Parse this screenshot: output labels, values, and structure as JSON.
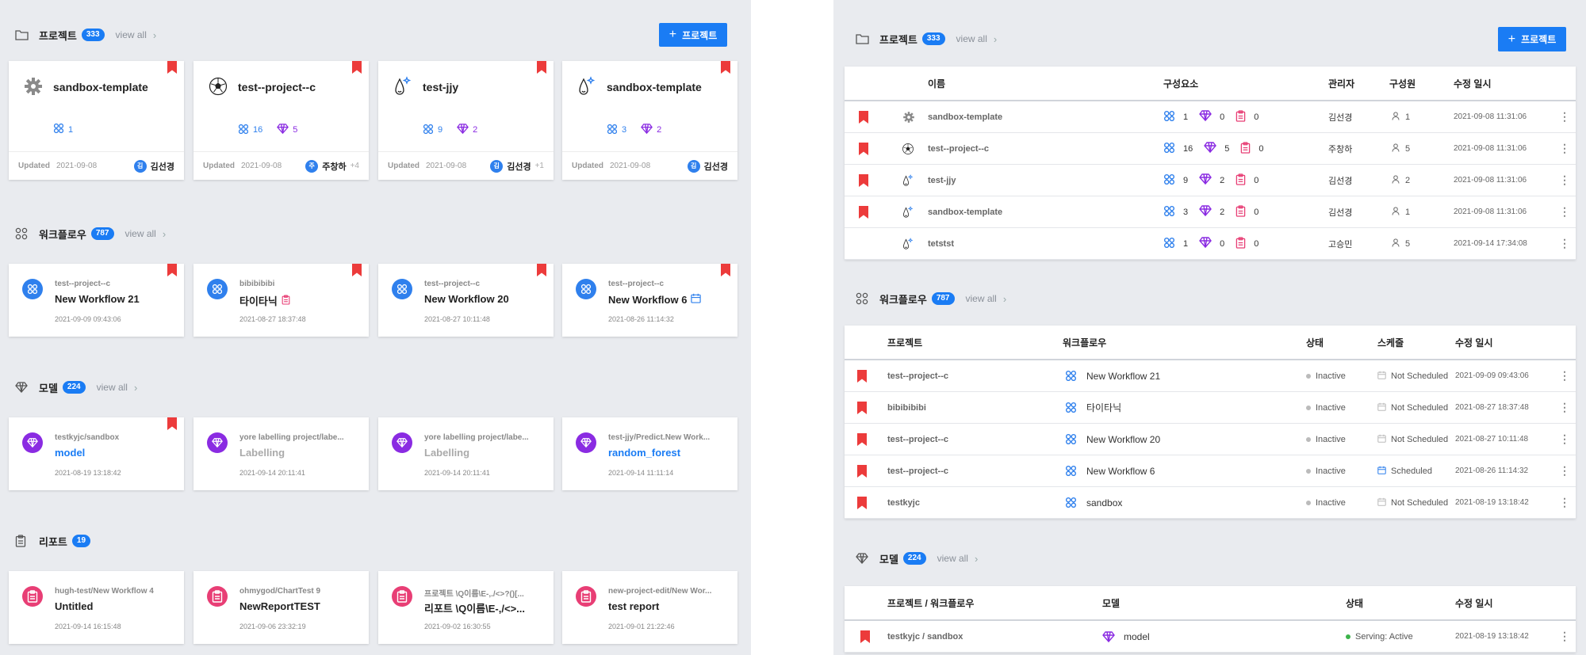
{
  "left": {
    "projects": {
      "title": "프로젝트",
      "count": "333",
      "view_all": "view all",
      "add_button": "프로젝트",
      "cards": [
        {
          "name": "sandbox-template",
          "icon": "gear-icon",
          "wf": "1",
          "md": "",
          "updated_label": "Updated",
          "date": "2021-09-08",
          "avatar": "김",
          "user": "김선경",
          "extra": "",
          "bookmarked": true
        },
        {
          "name": "test--project--c",
          "icon": "soccer-ball-icon",
          "wf": "16",
          "md": "5",
          "updated_label": "Updated",
          "date": "2021-09-08",
          "avatar": "주",
          "user": "주창하",
          "extra": "+4",
          "bookmarked": true
        },
        {
          "name": "test-jjy",
          "icon": "droplet-icon",
          "wf": "9",
          "md": "2",
          "updated_label": "Updated",
          "date": "2021-09-08",
          "avatar": "김",
          "user": "김선경",
          "extra": "+1",
          "bookmarked": true
        },
        {
          "name": "sandbox-template",
          "icon": "droplet-icon",
          "wf": "3",
          "md": "2",
          "updated_label": "Updated",
          "date": "2021-09-08",
          "avatar": "김",
          "user": "김선경",
          "extra": "",
          "bookmarked": true
        }
      ]
    },
    "workflows": {
      "title": "워크플로우",
      "count": "787",
      "view_all": "view all",
      "cards": [
        {
          "sub": "test--project--c",
          "title": "New Workflow 21",
          "date": "2021-09-09 09:43:06",
          "tag": "",
          "bookmarked": true
        },
        {
          "sub": "bibibibibi",
          "title": "타이타닉",
          "date": "2021-08-27 18:37:48",
          "tag": "report",
          "bookmarked": true
        },
        {
          "sub": "test--project--c",
          "title": "New Workflow 20",
          "date": "2021-08-27 10:11:48",
          "tag": "",
          "bookmarked": true
        },
        {
          "sub": "test--project--c",
          "title": "New Workflow 6",
          "date": "2021-08-26 11:14:32",
          "tag": "calendar",
          "bookmarked": true
        }
      ]
    },
    "models": {
      "title": "모델",
      "count": "224",
      "view_all": "view all",
      "cards": [
        {
          "sub": "testkyjc/sandbox",
          "title": "model",
          "date": "2021-08-19 13:18:42",
          "style": "blue",
          "bookmarked": true
        },
        {
          "sub": "yore labelling project/labe...",
          "title": "Labelling",
          "date": "2021-09-14 20:11:41",
          "style": "grey",
          "bookmarked": false
        },
        {
          "sub": "yore labelling project/labe...",
          "title": "Labelling",
          "date": "2021-09-14 20:11:41",
          "style": "grey",
          "bookmarked": false
        },
        {
          "sub": "test-jjy/Predict.New Work...",
          "title": "random_forest",
          "date": "2021-09-14 11:11:14",
          "style": "blue",
          "bookmarked": false
        }
      ]
    },
    "reports": {
      "title": "리포트",
      "count": "19",
      "cards": [
        {
          "sub": "hugh-test/New Workflow 4",
          "title": "Untitled",
          "date": "2021-09-14 16:15:48"
        },
        {
          "sub": "ohmygod/ChartTest 9",
          "title": "NewReportTEST",
          "date": "2021-09-06 23:32:19"
        },
        {
          "sub": "프로젝트 \\Q이름\\E-,./<>?()[...",
          "title": "리포트 \\Q이름\\E-,/<>...",
          "date": "2021-09-02 16:30:55"
        },
        {
          "sub": "new-project-edit/New Wor...",
          "title": "test report",
          "date": "2021-09-01 21:22:46"
        }
      ]
    }
  },
  "right": {
    "projects": {
      "title": "프로젝트",
      "count": "333",
      "view_all": "view all",
      "add_button": "프로젝트",
      "headers": {
        "name": "이름",
        "components": "구성요소",
        "manager": "관리자",
        "members": "구성원",
        "modified": "수정 일시"
      },
      "rows": [
        {
          "name": "sandbox-template",
          "icon": "gear-icon",
          "wf": "1",
          "md": "0",
          "rp": "0",
          "manager": "김선경",
          "members": "1",
          "date": "2021-09-08 11:31:06",
          "bookmarked": true
        },
        {
          "name": "test--project--c",
          "icon": "soccer-ball-icon",
          "wf": "16",
          "md": "5",
          "rp": "0",
          "manager": "주창하",
          "members": "5",
          "date": "2021-09-08 11:31:06",
          "bookmarked": true
        },
        {
          "name": "test-jjy",
          "icon": "droplet-icon",
          "wf": "9",
          "md": "2",
          "rp": "0",
          "manager": "김선경",
          "members": "2",
          "date": "2021-09-08 11:31:06",
          "bookmarked": true
        },
        {
          "name": "sandbox-template",
          "icon": "droplet-icon",
          "wf": "3",
          "md": "2",
          "rp": "0",
          "manager": "김선경",
          "members": "1",
          "date": "2021-09-08 11:31:06",
          "bookmarked": true
        },
        {
          "name": "tetstst",
          "icon": "droplet-icon",
          "wf": "1",
          "md": "0",
          "rp": "0",
          "manager": "고승민",
          "members": "5",
          "date": "2021-09-14 17:34:08",
          "bookmarked": false
        }
      ]
    },
    "workflows": {
      "title": "워크플로우",
      "count": "787",
      "view_all": "view all",
      "headers": {
        "project": "프로젝트",
        "workflow": "워크플로우",
        "status": "상태",
        "schedule": "스케줄",
        "modified": "수정 일시"
      },
      "rows": [
        {
          "project": "test--project--c",
          "workflow": "New Workflow 21",
          "status": "Inactive",
          "schedule": "Not Scheduled",
          "date": "2021-09-09 09:43:06"
        },
        {
          "project": "bibibibibi",
          "workflow": "타이타닉",
          "status": "Inactive",
          "schedule": "Not Scheduled",
          "date": "2021-08-27 18:37:48"
        },
        {
          "project": "test--project--c",
          "workflow": "New Workflow 20",
          "status": "Inactive",
          "schedule": "Not Scheduled",
          "date": "2021-08-27 10:11:48"
        },
        {
          "project": "test--project--c",
          "workflow": "New Workflow 6",
          "status": "Inactive",
          "schedule": "Scheduled",
          "date": "2021-08-26 11:14:32"
        },
        {
          "project": "testkyjc",
          "workflow": "sandbox",
          "status": "Inactive",
          "schedule": "Not Scheduled",
          "date": "2021-08-19 13:18:42"
        }
      ]
    },
    "models": {
      "title": "모델",
      "count": "224",
      "view_all": "view all",
      "headers": {
        "project": "프로젝트 / 워크플로우",
        "model": "모델",
        "status": "상태",
        "modified": "수정 일시"
      },
      "rows": [
        {
          "project": "testkyjc / sandbox",
          "model": "model",
          "status": "Serving: Active",
          "date": "2021-08-19 13:18:42"
        }
      ]
    }
  },
  "colors": {
    "accent": "#1a7cf4",
    "bookmark": "#ec3b3b",
    "workflow": "#2f80ed",
    "model": "#8a2be2",
    "report": "#e83e75",
    "background": "#e9ebef"
  }
}
